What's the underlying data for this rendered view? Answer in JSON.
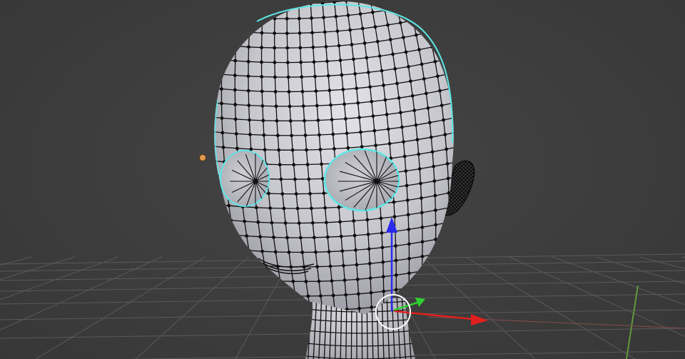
{
  "viewport": {
    "mode": "edit-mode-wireframe",
    "background_color": "#3d3d3d",
    "grid_color": "#5a5a5a"
  },
  "mesh": {
    "object": "head-mesh",
    "fill_color": "#c9c9cf",
    "wire_color": "#111111",
    "vertex_color": "#0d0d0d",
    "silhouette_highlight_color": "#5ee6e6",
    "features": [
      "eye-socket-left",
      "eye-socket-right",
      "mouth",
      "ear",
      "neck"
    ]
  },
  "light_object": {
    "icon": "light-dot-icon",
    "color": "#e19a4e"
  },
  "gizmo": {
    "x_axis_color": "#e0201f",
    "y_axis_color": "#2fd02f",
    "z_axis_color": "#2a2aee",
    "cursor_icon": "3d-cursor-icon",
    "cursor_color": "#ffffff"
  },
  "world_axes": {
    "y_axis_line_color": "#5f9a3a",
    "x_axis_line_color": "#a04040"
  }
}
